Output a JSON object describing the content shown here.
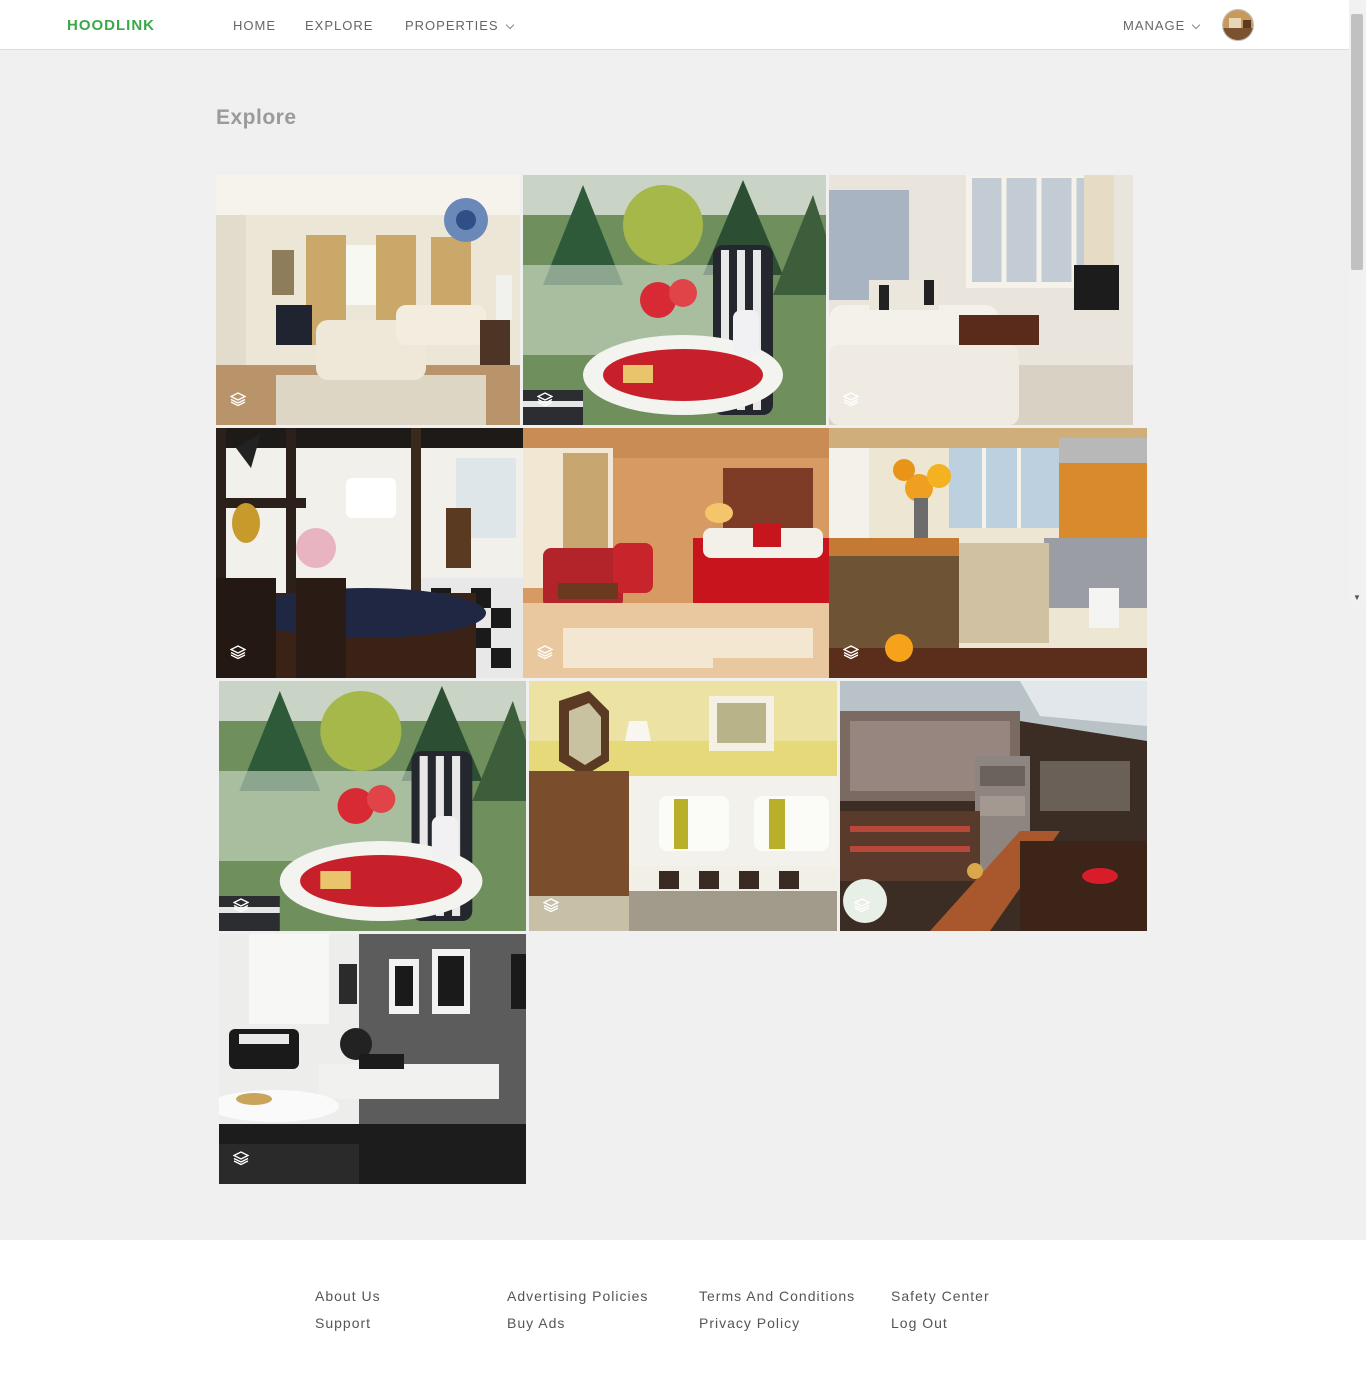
{
  "navbar": {
    "brand": "HOODLINK",
    "links": {
      "home": "HOME",
      "explore": "EXPLORE",
      "properties": "PROPERTIES"
    },
    "manage": "MANAGE"
  },
  "page": {
    "title": "Explore"
  },
  "gallery": {
    "tiles": [
      {
        "scene": "living room with chandelier"
      },
      {
        "scene": "balcony breakfast table"
      },
      {
        "scene": "white sofa living room"
      },
      {
        "scene": "dining room with checkered floor"
      },
      {
        "scene": "red hotel bedroom"
      },
      {
        "scene": "kitchen with sunflowers"
      },
      {
        "scene": "balcony breakfast table"
      },
      {
        "scene": "yellow bedroom"
      },
      {
        "scene": "stone fireplace lounge"
      },
      {
        "scene": "black and white living room"
      }
    ]
  },
  "footer": {
    "col1": [
      "About Us",
      "Support"
    ],
    "col2": [
      "Advertising Policies",
      "Buy Ads"
    ],
    "col3": [
      "Terms And Conditions",
      "Privacy Policy"
    ],
    "col4": [
      "Safety Center",
      "Log Out"
    ]
  },
  "colors": {
    "brand": "#3aa84a",
    "background": "#f0f0f0"
  }
}
